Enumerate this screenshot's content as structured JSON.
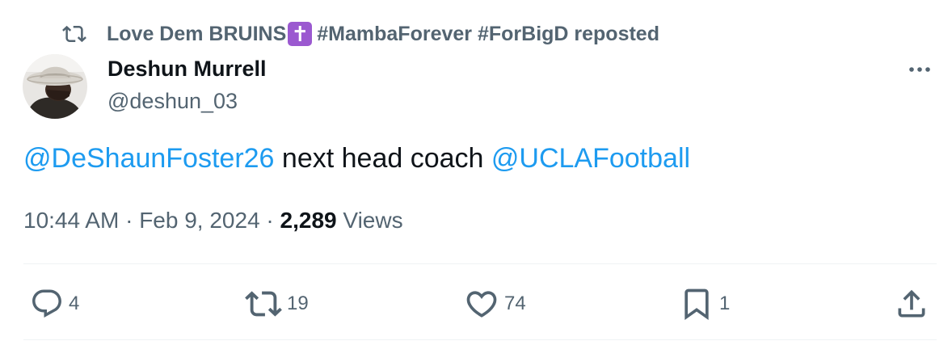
{
  "repost": {
    "icon": "repost-icon",
    "name_prefix": "Love Dem BRUINS",
    "emoji": "✝",
    "name_suffix": " #MambaForever #ForBigD reposted"
  },
  "author": {
    "display_name": "Deshun Murrell",
    "handle": "@deshun_03"
  },
  "tweet": {
    "mention1": "@DeShaunFoster26",
    "middle_text": " next head coach ",
    "mention2": "@UCLAFootball"
  },
  "meta": {
    "time": "10:44 AM",
    "separator1": " · ",
    "date": "Feb 9, 2024",
    "separator2": " · ",
    "views_count": "2,289",
    "views_label": " Views"
  },
  "actions": {
    "replies": "4",
    "reposts": "19",
    "likes": "74",
    "bookmarks": "1"
  },
  "colors": {
    "link": "#1d9bf0",
    "secondary_text": "#536471",
    "primary_text": "#0f1419",
    "emoji_bg": "#9b59d0"
  }
}
